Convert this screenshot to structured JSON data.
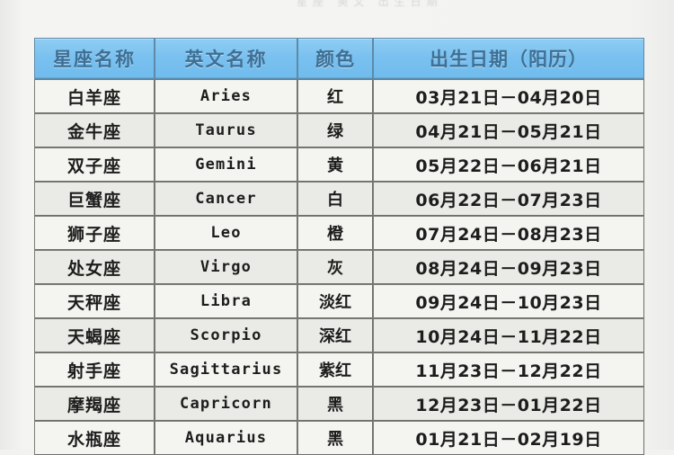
{
  "page": {
    "top_ghost_text": "星座  英文  出生日期",
    "background_color": "#f2f2f0"
  },
  "table": {
    "header_color": "#79c0ef",
    "header_text_color": "#3e6f94",
    "row_color": "#f4f4f1",
    "row_alt_color": "#eaeae6",
    "border_color": "#6e6e6a",
    "columns": [
      {
        "key": "name",
        "label": "星座名称"
      },
      {
        "key": "en",
        "label": "英文名称"
      },
      {
        "key": "color",
        "label": "颜色"
      },
      {
        "key": "date",
        "label": "出生日期（阳历）"
      }
    ],
    "rows": [
      {
        "name": "白羊座",
        "en": "Aries",
        "color": "红",
        "date": "03月21日－04月20日"
      },
      {
        "name": "金牛座",
        "en": "Taurus",
        "color": "绿",
        "date": "04月21日－05月21日"
      },
      {
        "name": "双子座",
        "en": "Gemini",
        "color": "黄",
        "date": "05月22日－06月21日"
      },
      {
        "name": "巨蟹座",
        "en": "Cancer",
        "color": "白",
        "date": "06月22日－07月23日"
      },
      {
        "name": "狮子座",
        "en": "Leo",
        "color": "橙",
        "date": "07月24日－08月23日"
      },
      {
        "name": "处女座",
        "en": "Virgo",
        "color": "灰",
        "date": "08月24日－09月23日"
      },
      {
        "name": "天秤座",
        "en": "Libra",
        "color": "淡红",
        "date": "09月24日－10月23日"
      },
      {
        "name": "天蝎座",
        "en": "Scorpio",
        "color": "深红",
        "date": "10月24日－11月22日"
      },
      {
        "name": "射手座",
        "en": "Sagittarius",
        "color": "紫红",
        "date": "11月23日－12月22日"
      },
      {
        "name": "摩羯座",
        "en": "Capricorn",
        "color": "黑",
        "date": "12月23日－01月22日"
      },
      {
        "name": "水瓶座",
        "en": "Aquarius",
        "color": "黑",
        "date": "01月21日－02月19日"
      }
    ]
  }
}
